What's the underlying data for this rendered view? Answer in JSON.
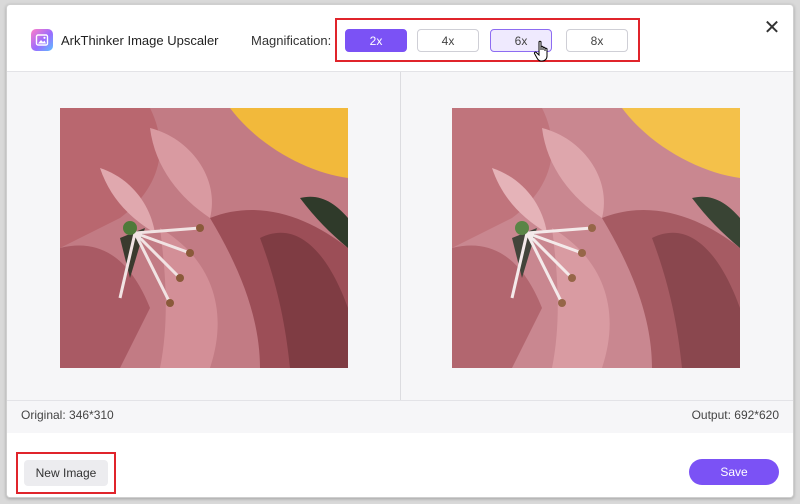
{
  "app": {
    "title": "ArkThinker Image Upscaler",
    "logo_icon": "image-upscaler-logo-icon"
  },
  "magnification": {
    "label": "Magnification:",
    "options": [
      {
        "label": "2x",
        "state": "selected"
      },
      {
        "label": "4x",
        "state": "normal"
      },
      {
        "label": "6x",
        "state": "hover"
      },
      {
        "label": "8x",
        "state": "normal"
      }
    ]
  },
  "close_icon": "close-icon",
  "preview": {
    "original_label": "Original: 346*310",
    "output_label": "Output: 692*620"
  },
  "footer": {
    "new_image_label": "New Image",
    "save_label": "Save"
  },
  "colors": {
    "accent": "#7b52f5",
    "highlight_outline": "#e0242b"
  }
}
